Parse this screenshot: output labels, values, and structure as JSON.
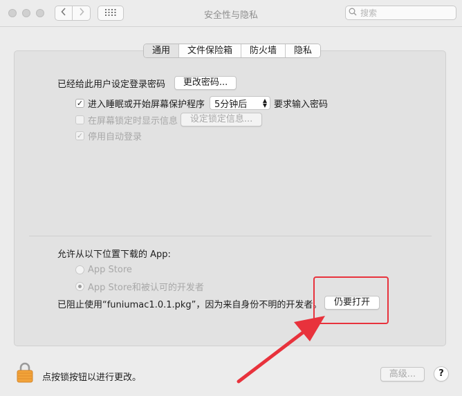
{
  "window": {
    "title": "安全性与隐私"
  },
  "toolbar": {
    "search_placeholder": "搜索"
  },
  "tabs": [
    {
      "label": "通用",
      "active": true
    },
    {
      "label": "文件保险箱",
      "active": false
    },
    {
      "label": "防火墙",
      "active": false
    },
    {
      "label": "隐私",
      "active": false
    }
  ],
  "general": {
    "password_set_label": "已经给此用户设定登录密码",
    "change_password_button": "更改密码...",
    "require_password": {
      "label_before": "进入睡眠或开始屏幕保护程序",
      "selected_delay": "5分钟后",
      "label_after": "要求输入密码",
      "checked": true
    },
    "show_message": {
      "label": "在屏幕锁定时显示信息",
      "button": "设定锁定信息...",
      "checked": false
    },
    "disable_autologin": {
      "label": "停用自动登录",
      "checked": true
    }
  },
  "downloads": {
    "heading": "允许从以下位置下载的 App:",
    "options": [
      {
        "label": "App Store",
        "selected": false
      },
      {
        "label": "App Store和被认可的开发者",
        "selected": true
      }
    ],
    "blocked_message": "已阻止使用“funiumac1.0.1.pkg”，因为来自身份不明的开发者。",
    "open_anyway_button": "仍要打开"
  },
  "footer": {
    "lock_message": "点按锁按钮以进行更改。",
    "advanced_button": "高级...",
    "help_button": "?"
  },
  "colors": {
    "highlight": "#e8323c",
    "lock": "#f2a33a"
  }
}
